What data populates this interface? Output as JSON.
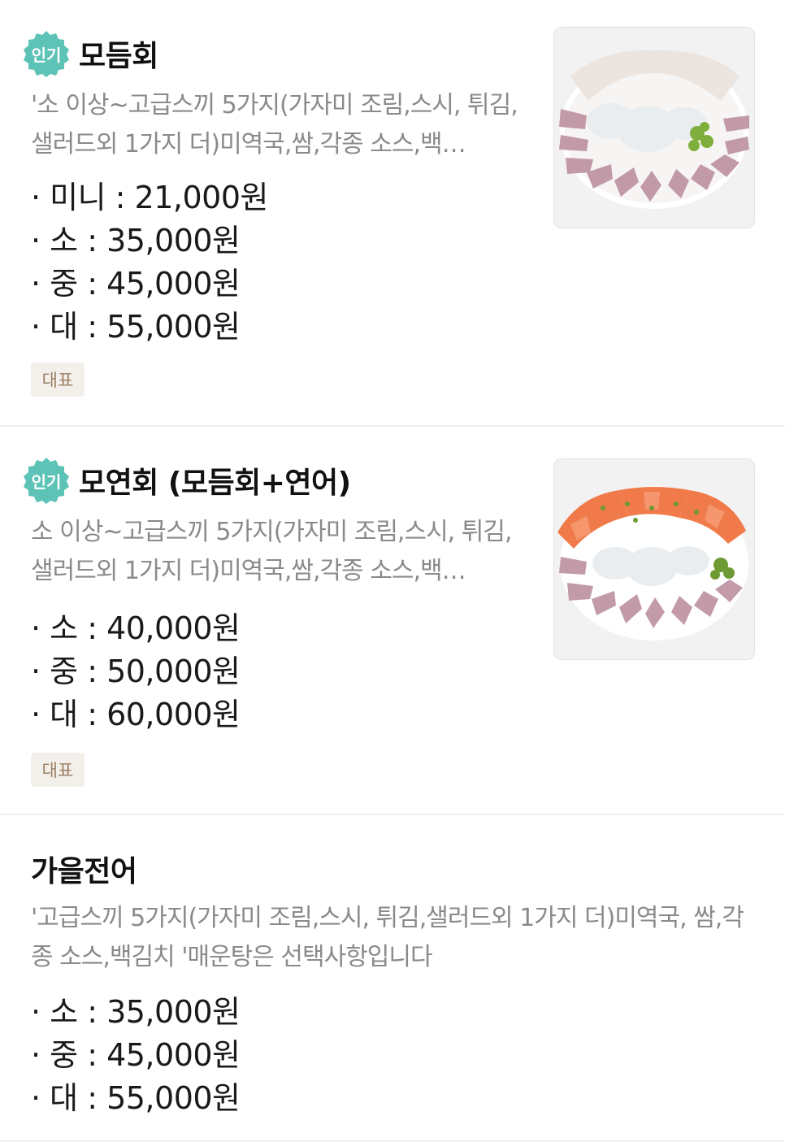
{
  "items": [
    {
      "badge": "인기",
      "title": "모듬회",
      "description": "'소 이상~고급스끼 5가지(가자미 조림,스시, 튀김,샐러드외 1가지 더)미역국,쌈,각종 소스,백…",
      "prices": [
        "· 미니 : 21,000원",
        "· 소 : 35,000원",
        "· 중 : 45,000원",
        "· 대 : 55,000원"
      ],
      "tag": "대표",
      "image_icon": "sashimi-platter-photo"
    },
    {
      "badge": "인기",
      "title": "모연회 (모듬회+연어)",
      "description": "소 이상~고급스끼 5가지(가자미 조림,스시, 튀김,샐러드외 1가지 더)미역국,쌈,각종 소스,백…",
      "prices": [
        "· 소 : 40,000원",
        "· 중 : 50,000원",
        "· 대 : 60,000원"
      ],
      "tag": "대표",
      "image_icon": "salmon-sashimi-platter-photo"
    },
    {
      "title": "가을전어",
      "description": "'고급스끼 5가지(가자미 조림,스시, 튀김,샐러드외 1가지 더)미역국, 쌈,각종 소스,백김치 '매운탕은 선택사항입니다",
      "prices": [
        "· 소 : 35,000원",
        "· 중 : 45,000원",
        "· 대 : 55,000원"
      ]
    }
  ],
  "colors": {
    "badge": "#5cc3b6",
    "tag_bg": "#f3efea",
    "tag_text": "#9b7f64",
    "description": "#8a8a8a"
  }
}
